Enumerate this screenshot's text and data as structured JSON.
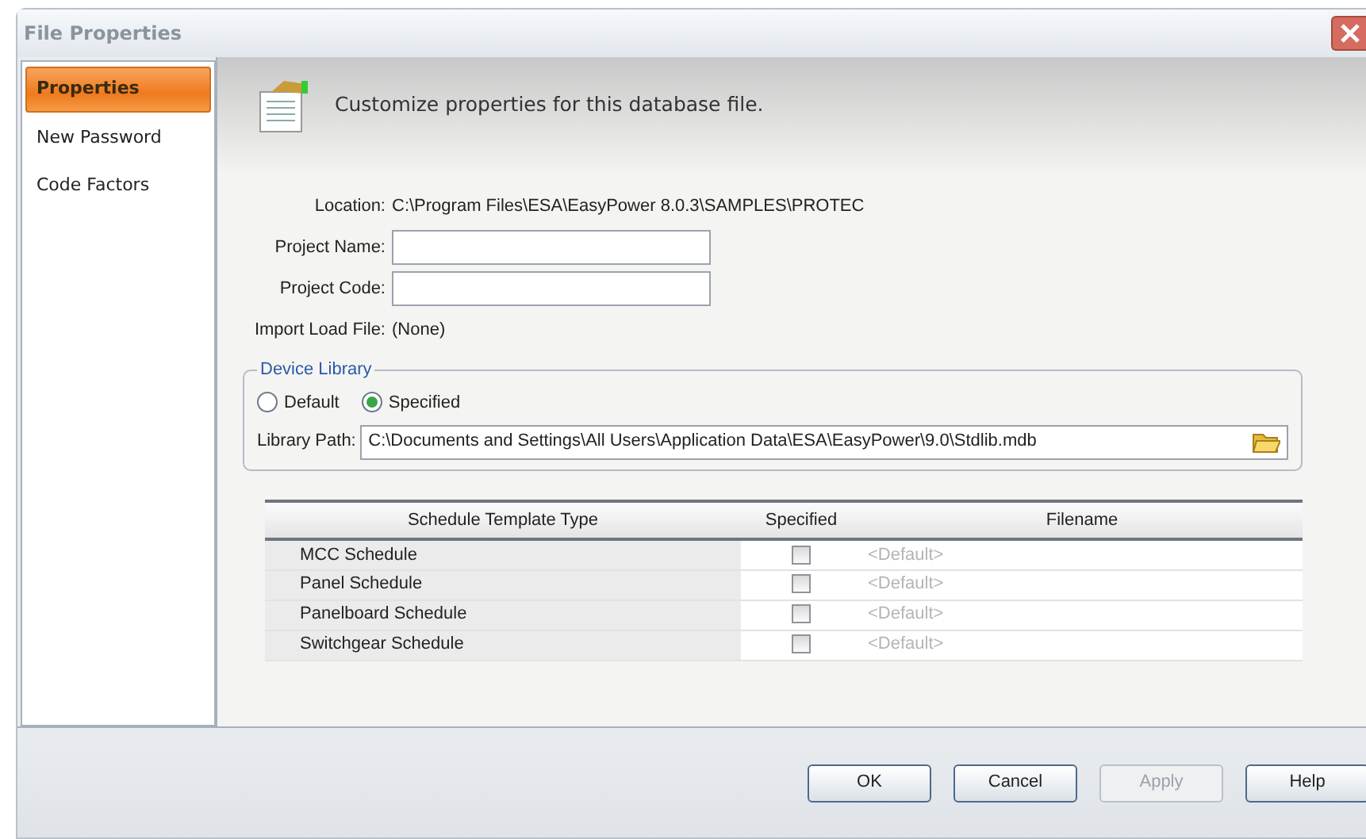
{
  "window": {
    "title": "File Properties"
  },
  "sidebar": {
    "items": [
      {
        "label": "Properties",
        "selected": true
      },
      {
        "label": "New Password",
        "selected": false
      },
      {
        "label": "Code Factors",
        "selected": false
      }
    ]
  },
  "header": {
    "text": "Customize properties for this database file."
  },
  "location": {
    "label": "Location:",
    "value": "C:\\Program Files\\ESA\\EasyPower 8.0.3\\SAMPLES\\PROTEC"
  },
  "fields": [
    {
      "label": "Project Name:"
    },
    {
      "label": "Project Code:"
    }
  ],
  "import_load_file": {
    "label": "Import Load File:",
    "value": "(None)"
  },
  "device_library": {
    "title": "Device Library",
    "options": [
      {
        "label": "Default",
        "selected": false
      },
      {
        "label": "Specified",
        "selected": true
      }
    ],
    "path_label": "Library Path:",
    "path": "C:\\Documents and Settings\\All Users\\Application Data\\ESA\\EasyPower\\9.0\\Stdlib.mdb"
  },
  "table": {
    "columns": [
      "Schedule Template Type",
      "Specified",
      "Filename"
    ],
    "rows": [
      {
        "type": "MCC Schedule",
        "checked": false,
        "filename": "<Default>"
      },
      {
        "type": "Panel Schedule",
        "checked": false,
        "filename": "<Default>"
      },
      {
        "type": "Panelboard Schedule",
        "checked": false,
        "filename": "<Default>"
      },
      {
        "type": "Switchgear Schedule",
        "checked": false,
        "filename": "<Default>"
      }
    ]
  },
  "buttons": [
    {
      "label": "OK",
      "disabled": false
    },
    {
      "label": "Cancel",
      "disabled": false
    },
    {
      "label": "Apply",
      "disabled": true
    },
    {
      "label": "Help",
      "disabled": false
    }
  ]
}
